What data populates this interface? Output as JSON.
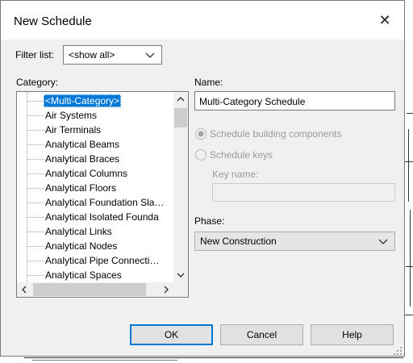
{
  "dialog": {
    "title": "New Schedule",
    "close_label": "✕"
  },
  "filter": {
    "label": "Filter list:",
    "value": "<show all>"
  },
  "category": {
    "label": "Category:",
    "items": [
      "<Multi-Category>",
      "Air Systems",
      "Air Terminals",
      "Analytical Beams",
      "Analytical Braces",
      "Analytical Columns",
      "Analytical Floors",
      "Analytical Foundation Sla…",
      "Analytical Isolated Founda",
      "Analytical Links",
      "Analytical Nodes",
      "Analytical Pipe Connecti…",
      "Analytical Spaces"
    ],
    "selected_index": 0
  },
  "name": {
    "label": "Name:",
    "value": "Multi-Category Schedule"
  },
  "options": {
    "schedule_components": "Schedule building components",
    "schedule_keys": "Schedule keys",
    "key_name_label": "Key name:",
    "key_name_value": ""
  },
  "phase": {
    "label": "Phase:",
    "value": "New Construction"
  },
  "buttons": {
    "ok": "OK",
    "cancel": "Cancel",
    "help": "Help"
  },
  "colors": {
    "accent": "#0078d7",
    "dialog_bg": "#f0f0f0",
    "disabled_text": "#9a9a9a"
  }
}
